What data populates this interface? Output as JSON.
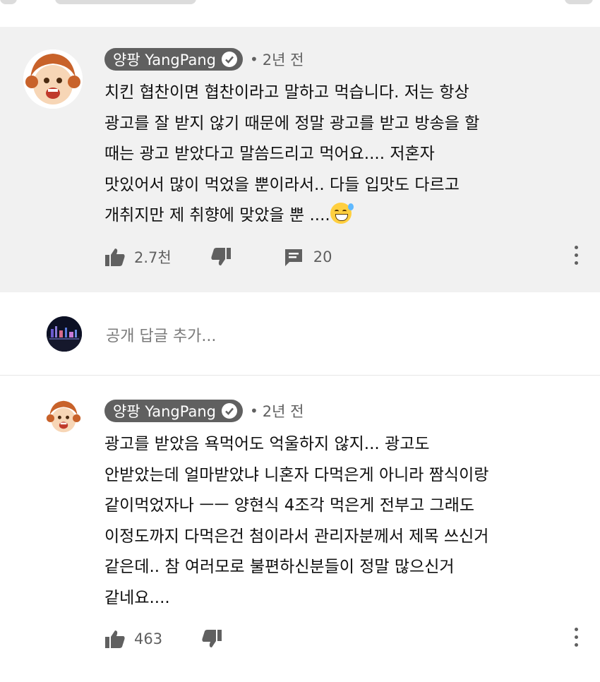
{
  "comments": [
    {
      "author": "양팡 YangPang",
      "time": "2년 전",
      "text": "치킨 협찬이면 협찬이라고 말하고 먹습니다. 저는 항상\n광고를 잘 받지 않기 때문에 정말 광고를 받고 방송을 할\n때는 광고 받았다고 말씀드리고 먹어요.... 저혼자\n맛있어서 많이 먹었을 뿐이라서.. 다들 입맛도 다르고\n개취지만 제 취향에 맞았을 뿐 ....",
      "likes": "2.7천",
      "replies": "20"
    },
    {
      "author": "양팡 YangPang",
      "time": "2년 전",
      "text": "광고를 받았음 욕먹어도 억울하지 않지... 광고도\n안받았는데 얼마받았냐 니혼자 다먹은게 아니라 짬식이랑\n같이먹었자나 ㅡㅡ 양현식 4조각 먹은게 전부고 그래도\n이정도까지 다먹은건 첨이라서 관리자분께서 제목 쓰신거\n같은데.. 참 여러모로 불편하신분들이 정말 많으신거\n같네요....",
      "likes": "463"
    }
  ],
  "reply_box": {
    "placeholder": "공개 답글 추가..."
  },
  "icons": {
    "like": "thumbs-up-icon",
    "dislike": "thumbs-down-icon",
    "reply": "comment-icon",
    "more": "more-vert-icon",
    "verified": "check-circle-icon",
    "emoji": "grinning-sweat-emoji"
  },
  "colors": {
    "highlight_bg": "#f1f1f1",
    "badge_bg": "#606060",
    "secondary_text": "#606060"
  }
}
